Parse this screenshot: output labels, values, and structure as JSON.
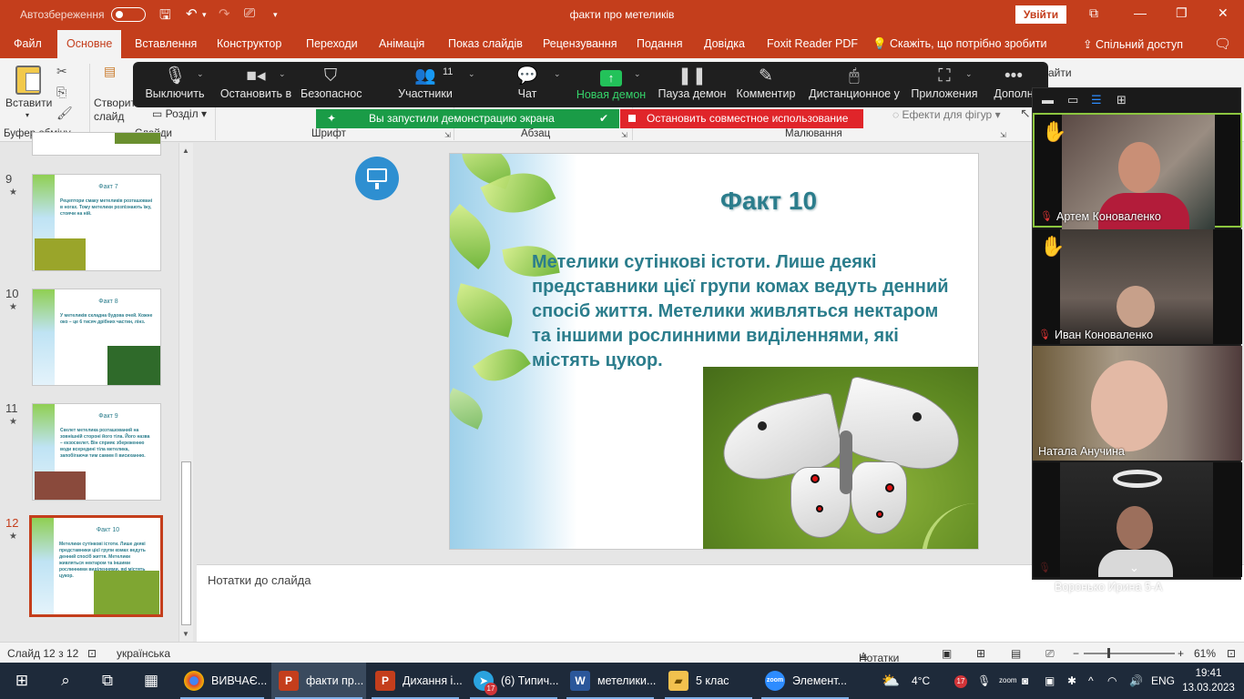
{
  "titlebar": {
    "autosave_label": "Автозбереження",
    "document_title": "факти про метеликів",
    "signin_label": "Увійти"
  },
  "ribbon_tabs": [
    "Файл",
    "Основне",
    "Вставлення",
    "Конструктор",
    "Переходи",
    "Анімація",
    "Показ слайдів",
    "Рецензування",
    "Подання",
    "Довідка",
    "Foxit Reader PDF",
    "Скажіть, що потрібно зробити"
  ],
  "active_tab": "Основне",
  "share_label": "Спільний доступ",
  "ribbon": {
    "paste_label": "Вставити",
    "clipboard_group": "Буфер обміну",
    "create_slide_label": "Створити слайд",
    "section_label": "Розділ",
    "slides_group": "Слайди",
    "font_group": "Шрифт",
    "paragraph_group": "Абзац",
    "drawing_group": "Малювання",
    "shape_effects_label": "Ефекти для фігур",
    "partial_right_label": "айти"
  },
  "zoom_toolbar": {
    "buttons": [
      {
        "label": "Выключить",
        "icon": "microphone-icon"
      },
      {
        "label": "Остановить в",
        "icon": "video-camera-icon"
      },
      {
        "label": "Безопаснос",
        "icon": "shield-icon"
      },
      {
        "label": "Участники",
        "icon": "participants-icon",
        "count": "11"
      },
      {
        "label": "Чат",
        "icon": "chat-icon"
      },
      {
        "label": "Новая демон",
        "icon": "share-screen-icon"
      },
      {
        "label": "Пауза демон",
        "icon": "pause-icon"
      },
      {
        "label": "Комментир",
        "icon": "pen-icon"
      },
      {
        "label": "Дистанционное у",
        "icon": "mouse-icon"
      },
      {
        "label": "Приложения",
        "icon": "apps-icon"
      },
      {
        "label": "Дополн",
        "icon": "more-icon"
      }
    ],
    "sharing_notice": "Вы запустили демонстрацию экрана",
    "stop_sharing_label": "Остановить совместное использование"
  },
  "thumbnails": [
    {
      "number": "9",
      "title": "Факт 7",
      "text": "Рецептори смаку метеликів розташовані в ногах. Тому метелики розпізнають їжу, стоячи на ній."
    },
    {
      "number": "10",
      "title": "Факт 8",
      "text": "У метеликів складна будова очей. Кожне око – це 6 тисяч дрібних частин, лінз."
    },
    {
      "number": "11",
      "title": "Факт 9",
      "text": "Скелет метелика розташований на зовнішній стороні його тіла. Його назва – екзоскелет. Він сприяє збереженню води всередині тіла метелика, запобігаючи тим самим її висиханню."
    },
    {
      "number": "12",
      "title": "Факт 10",
      "text": "Метелики сутінкові істоти. Лише деякі представники цієї групи комах ведуть денний спосіб життя. Метелики живляться нектаром та іншими рослинними виділеннями, які містять цукор."
    }
  ],
  "slide": {
    "title": "Факт 10",
    "body": "Метелики сутінкові істоти. Лише деякі представники цієї групи комах ведуть денний спосіб життя. Метелики живляться нектаром та іншими рослинними виділеннями, які містять цукор."
  },
  "notes_placeholder": "Нотатки до слайда",
  "participants": [
    {
      "name": "Артем Коноваленко",
      "hand_raised": true,
      "muted": true
    },
    {
      "name": "Иван Коноваленко",
      "hand_raised": true,
      "muted": true
    },
    {
      "name": "Натала Анучина",
      "hand_raised": false,
      "muted": false
    },
    {
      "name": "Воронько Ирина 5-А",
      "hand_raised": false,
      "muted": true
    }
  ],
  "statusbar": {
    "slide_info": "Слайд 12 з 12",
    "language": "українська",
    "notes_label": "Нотатки",
    "zoom_level": "61%"
  },
  "taskbar": {
    "apps": [
      {
        "label": "ВИВЧАЄ...",
        "icon": "chrome-icon"
      },
      {
        "label": "факти пр...",
        "icon": "powerpoint-icon"
      },
      {
        "label": "Дихання і...",
        "icon": "powerpoint-icon"
      },
      {
        "label": "(6) Типич...",
        "icon": "telegram-icon",
        "badge": "17"
      },
      {
        "label": "метелики...",
        "icon": "word-icon"
      },
      {
        "label": "5 клас",
        "icon": "folder-icon"
      },
      {
        "label": "Элемент...",
        "icon": "zoom-icon"
      }
    ],
    "weather": "4°C",
    "tray_badge": "17",
    "input_language": "ENG",
    "time": "19:41",
    "date": "13.03.2023"
  },
  "colors": {
    "powerpoint_red": "#c43e1c",
    "slide_text": "#2b7d8c",
    "zoom_green": "#1a9c47",
    "zoom_red": "#e0252a"
  }
}
